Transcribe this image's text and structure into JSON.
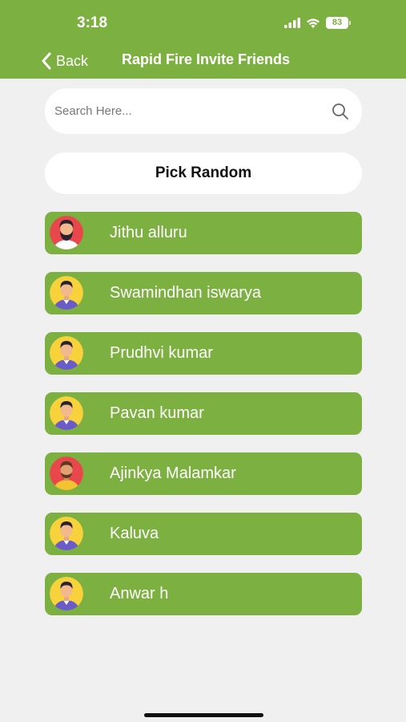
{
  "status_bar": {
    "time": "3:18",
    "battery": "83",
    "icons": [
      "signal-icon",
      "wifi-icon",
      "battery-icon"
    ]
  },
  "nav": {
    "back_label": "Back",
    "title": "Rapid Fire Invite Friends"
  },
  "search": {
    "placeholder": "Search Here...",
    "value": ""
  },
  "pick_random_label": "Pick Random",
  "friends": [
    {
      "name": "Jithu alluru",
      "avatar": "bearded-man-avatar"
    },
    {
      "name": "Swamindhan iswarya",
      "avatar": "man-avatar"
    },
    {
      "name": "Prudhvi kumar",
      "avatar": "man-avatar"
    },
    {
      "name": "Pavan kumar",
      "avatar": "man-avatar"
    },
    {
      "name": "Ajinkya Malamkar",
      "avatar": "man-orange-avatar"
    },
    {
      "name": "Kaluva",
      "avatar": "man-avatar"
    },
    {
      "name": "Anwar h",
      "avatar": "man-avatar"
    }
  ],
  "colors": {
    "accent": "#7cb040",
    "background": "#f0f0f0",
    "card": "#ffffff"
  }
}
